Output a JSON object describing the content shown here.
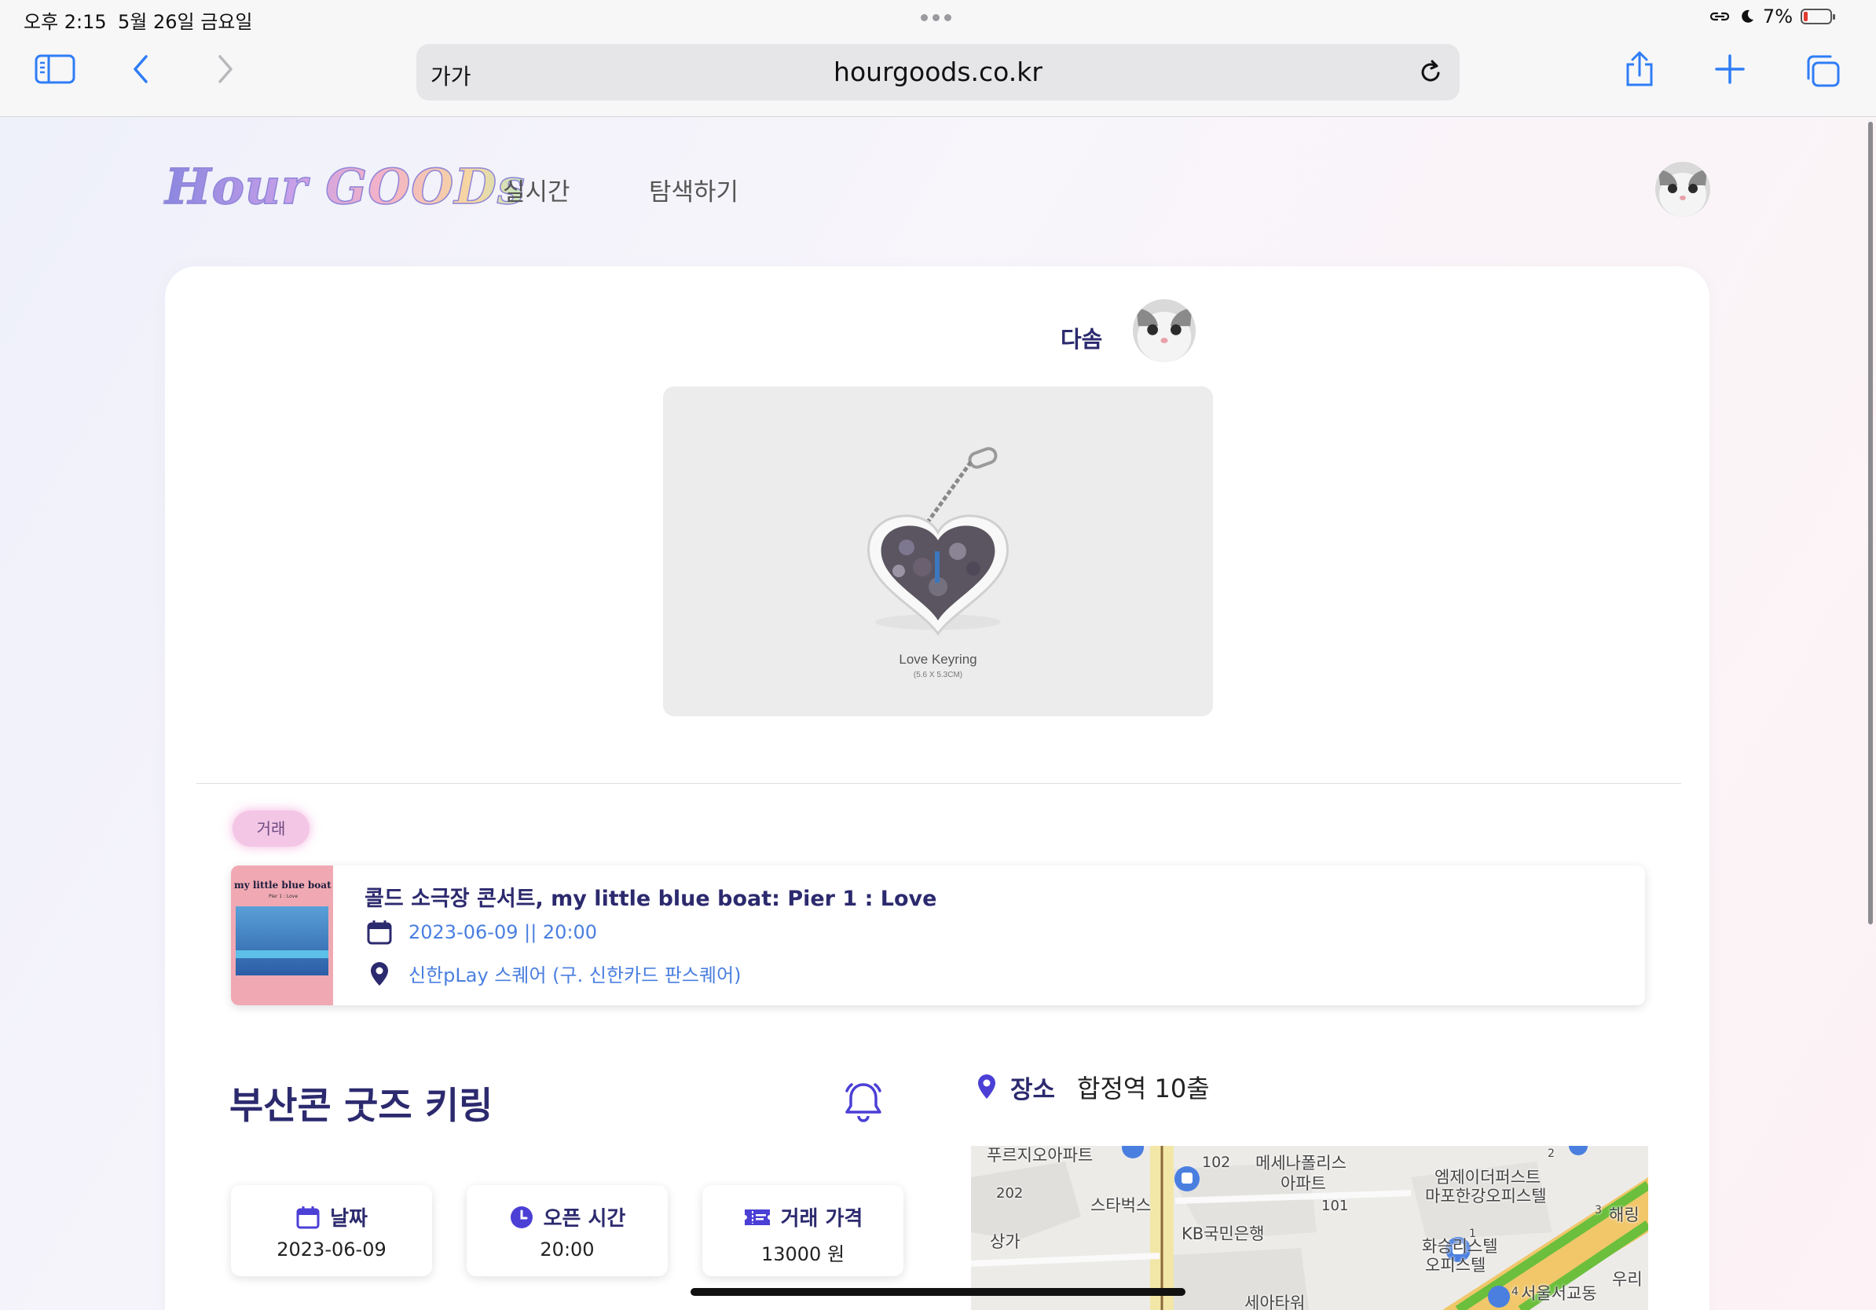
{
  "status_bar": {
    "time": "오후 2:15",
    "date": "5월 26일 금요일",
    "battery": "7%"
  },
  "browser": {
    "text_size_label": "가가",
    "url": "hourgoods.co.kr"
  },
  "site": {
    "logo": "Hour GOODs",
    "nav": [
      "실시간",
      "탐색하기"
    ]
  },
  "post": {
    "seller": "다솜",
    "image_caption": "Love Keyring",
    "image_caption_sub": "(5.6 X 5.3CM)",
    "tag": "거래"
  },
  "event": {
    "poster_title": "my little blue boat",
    "poster_subtitle": "Pier 1 : Love",
    "title": "콜드 소극장 콘서트, my little blue boat: Pier 1 : Love",
    "datetime": "2023-06-09 || 20:00",
    "venue": "신한pLay 스퀘어 (구. 신한카드 판스퀘어)"
  },
  "goods": {
    "title": "부산콘 굿즈 키링",
    "info": [
      {
        "label": "날짜",
        "value": "2023-06-09",
        "icon": "calendar-icon"
      },
      {
        "label": "오픈 시간",
        "value": "20:00",
        "icon": "clock-icon"
      },
      {
        "label": "거래 가격",
        "value": "13000 원",
        "icon": "ticket-icon"
      }
    ]
  },
  "place": {
    "label": "장소",
    "value": "합정역 10출"
  },
  "map_labels": [
    "푸르지오아파트",
    "102",
    "메세나폴리스",
    "아파트",
    "202",
    "스타벅스",
    "101",
    "상가",
    "KB국민은행",
    "엠제이더퍼스트",
    "마포한강오피스텔",
    "화승리스텔",
    "오피스텔",
    "세아타워",
    "서울서교동",
    "우리",
    "해링",
    "2",
    "1",
    "3",
    "4"
  ],
  "colors": {
    "brand_navy": "#2c2a6e",
    "accent_blue": "#4a7fe0",
    "icon_purple": "#4b3fd6",
    "tag_pink": "#f4c6e6"
  }
}
